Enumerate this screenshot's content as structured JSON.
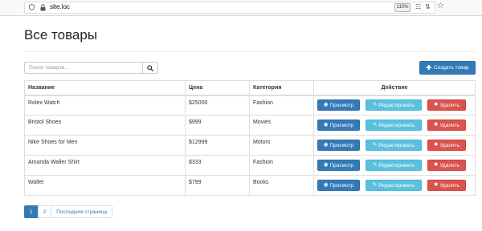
{
  "browser": {
    "url": "site.loc",
    "zoom": "110%"
  },
  "page": {
    "title": "Все товары"
  },
  "search": {
    "placeholder": "Поиск товаров..."
  },
  "toolbar": {
    "create_label": "Создать товар"
  },
  "table": {
    "headers": {
      "name": "Название",
      "price": "Цена",
      "category": "Категория",
      "action": "Действие"
    },
    "rows": [
      {
        "name": "Rolex Watch",
        "price": "$25000",
        "category": "Fashion"
      },
      {
        "name": "Bristol Shoes",
        "price": "$999",
        "category": "Movies"
      },
      {
        "name": "Nike Shoes for Men",
        "price": "$12999",
        "category": "Motors"
      },
      {
        "name": "Amanda Waller Shirt",
        "price": "$333",
        "category": "Fashion"
      },
      {
        "name": "Wallet",
        "price": "$799",
        "category": "Books"
      }
    ],
    "actions": {
      "view": "Просмотр",
      "edit": "Редактировать",
      "delete": "Удалить"
    }
  },
  "pagination": {
    "pages": [
      "1",
      "2"
    ],
    "last_page": "Последняя страница",
    "active_page": "1"
  },
  "icons": {
    "view": "eye-icon",
    "edit": "edit-icon",
    "delete": "times-icon",
    "search": "search-icon",
    "create": "plus-icon"
  },
  "colors": {
    "primary": "#337ab7",
    "info": "#5bc0de",
    "danger": "#d9534f"
  }
}
